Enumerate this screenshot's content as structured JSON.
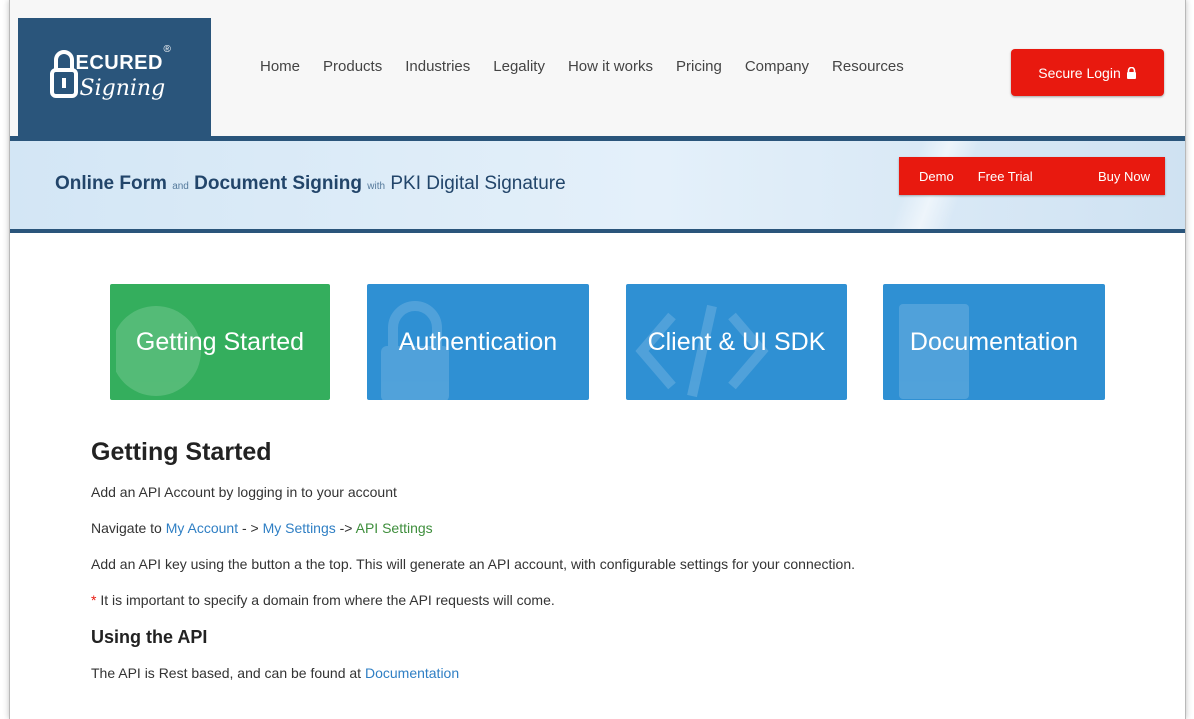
{
  "logo": {
    "top": "ECURED",
    "bottom": "Signing",
    "reg": "®"
  },
  "nav": {
    "items": [
      {
        "label": "Home"
      },
      {
        "label": "Products"
      },
      {
        "label": "Industries"
      },
      {
        "label": "Legality"
      },
      {
        "label": "How it works"
      },
      {
        "label": "Pricing"
      },
      {
        "label": "Company"
      },
      {
        "label": "Resources"
      }
    ],
    "login_label": "Secure Login"
  },
  "banner": {
    "part1": "Online Form",
    "part2": "and",
    "part3": "Document Signing",
    "part4": "with",
    "part5": "PKI Digital Signature",
    "cta_demo": "Demo",
    "cta_trial": "Free Trial",
    "cta_buy": "Buy Now"
  },
  "tiles": {
    "getting_started": "Getting Started",
    "authentication": "Authentication",
    "sdk": "Client & UI SDK",
    "documentation": "Documentation"
  },
  "content": {
    "heading": "Getting Started",
    "p1": "Add an API Account by logging in to your account",
    "p2_prefix": "Navigate to ",
    "p2_link1": "My Account",
    "p2_sep1": " - > ",
    "p2_link2": "My Settings",
    "p2_sep2": " -> ",
    "p2_link3": "API Settings",
    "p3": "Add an API key using the button a the top. This will generate an API account, with configurable settings for your connection.",
    "p4_star": "*",
    "p4": " It is important to specify a domain from where the API requests will come.",
    "subheading": "Using the API",
    "p5_prefix": "The API is Rest based, and can be found at ",
    "p5_link": "Documentation"
  },
  "colors": {
    "brand_navy": "#2a557b",
    "accent_red": "#e8190f",
    "tile_green": "#34ae5d",
    "tile_blue": "#2f90d3"
  }
}
